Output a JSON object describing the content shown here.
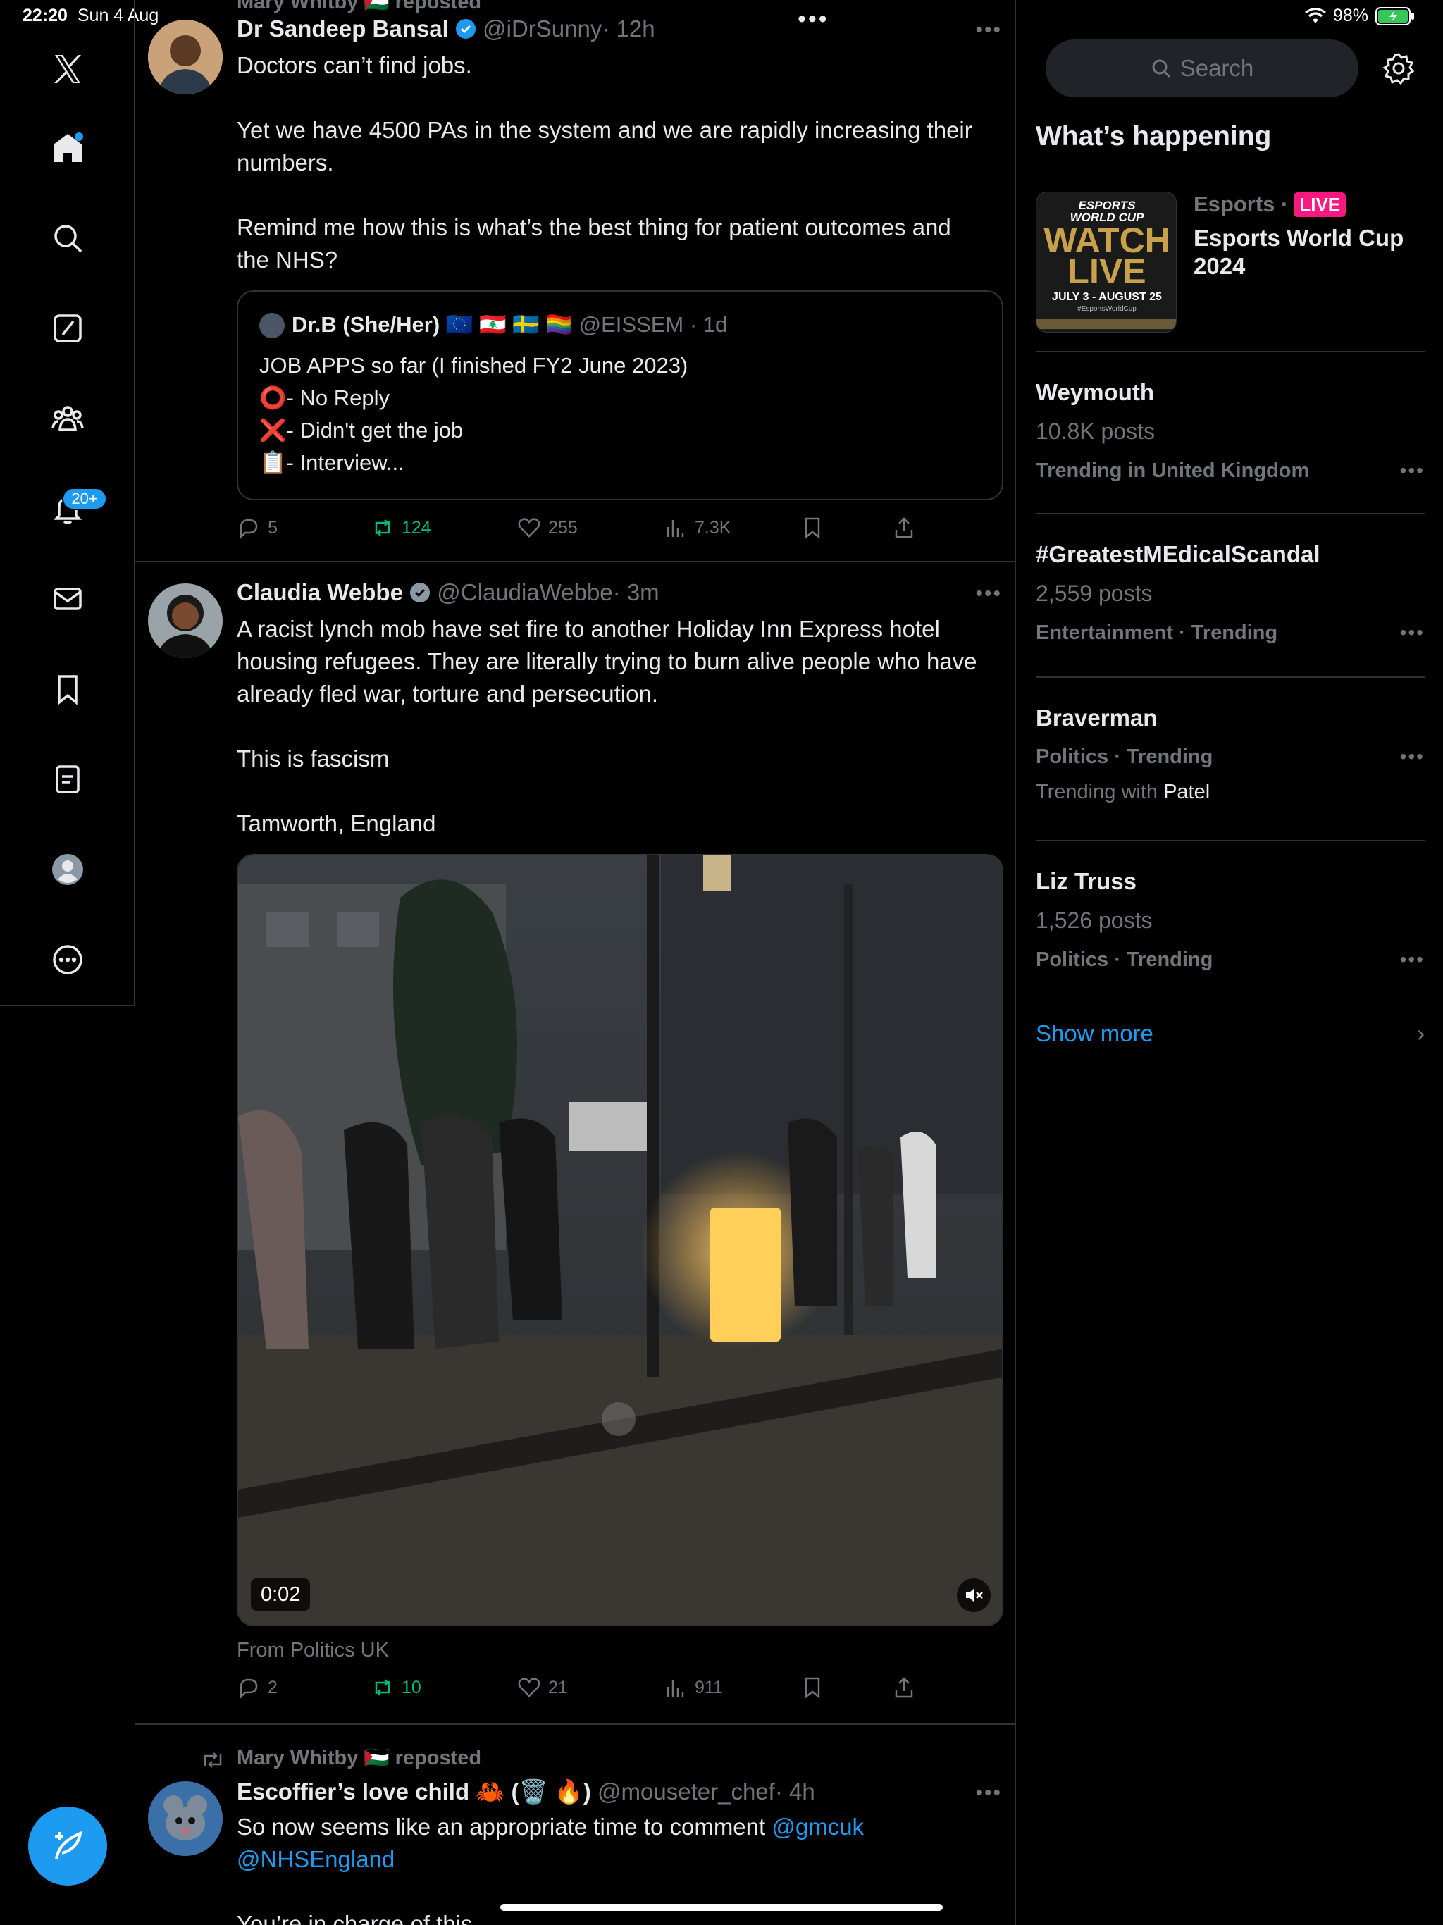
{
  "status_bar": {
    "time": "22:20",
    "date": "Sun 4 Aug",
    "battery": "98%"
  },
  "nav": {
    "notifications_badge": "20+"
  },
  "tweets": [
    {
      "reposted_by": "Mary Whitby 🇵🇸 reposted",
      "name": "Dr Sandeep Bansal",
      "handle": "@iDrSunny",
      "time": "· 12h",
      "body": "Doctors can’t find jobs.\n\nYet we have 4500 PAs in the system and we are rapidly increasing their numbers.\n\nRemind me how this is what’s the best thing for patient outcomes and the NHS?",
      "quote": {
        "name": "Dr.B (She/Her) 🇪🇺 🇱🇧 🇸🇪 🏳️‍🌈",
        "handle": "@EISSEM · 1d",
        "lines": [
          "JOB APPS so far (I finished FY2 June 2023)",
          "⭕- No Reply",
          "❌- Didn't get the job",
          "📋- Interview..."
        ]
      },
      "replies": "5",
      "reposts": "124",
      "likes": "255",
      "views": "7.3K"
    },
    {
      "name": "Claudia Webbe",
      "handle": "@ClaudiaWebbe",
      "time": "· 3m",
      "body": "A racist lynch mob have set fire to another Holiday Inn Express hotel housing refugees. They are literally trying to burn alive people who have already fled war, torture and persecution.\n\nThis is fascism\n\nTamworth, England",
      "video_time": "0:02",
      "source": "From Politics UK",
      "replies": "2",
      "reposts": "10",
      "likes": "21",
      "views": "911"
    },
    {
      "reposted_by": "Mary Whitby 🇵🇸 reposted",
      "name": "Escoffier’s love child 🦀 (🗑️ 🔥)",
      "handle": "@mouseter_chef",
      "time": "· 4h",
      "body_text": "So now seems like an appropriate time to comment ",
      "mention1": "@gmcuk",
      "mention2": "@NHSEngland",
      "cut_text": "You’re in charge of this"
    }
  ],
  "sidebar": {
    "search_placeholder": "Search",
    "heading": "What’s happening",
    "featured": {
      "category": "Esports ·",
      "badge": "LIVE",
      "title": "Esports World Cup 2024",
      "thumb_title1": "ESPORTS",
      "thumb_title2": "WORLD CUP",
      "thumb_watch": "WATCH",
      "thumb_live": "LIVE",
      "thumb_dates": "JULY 3 - AUGUST 25",
      "thumb_tag": "#EsportsWorldCup"
    },
    "trends": [
      {
        "title": "Weymouth",
        "posts": "10.8K posts",
        "context": "Trending in United Kingdom"
      },
      {
        "title": "#GreatestMEdicalScandal",
        "posts": "2,559 posts",
        "context": "Entertainment · Trending"
      },
      {
        "title": "Braverman",
        "context": "Politics · Trending",
        "with_label": "Trending with",
        "with_name": "Patel"
      },
      {
        "title": "Liz Truss",
        "posts": "1,526 posts",
        "context": "Politics · Trending"
      }
    ],
    "show_more": "Show more"
  },
  "colors": {
    "accent": "#1d9bf0",
    "repost": "#00ba7c",
    "live": "#f91880",
    "muted": "#71767b"
  }
}
